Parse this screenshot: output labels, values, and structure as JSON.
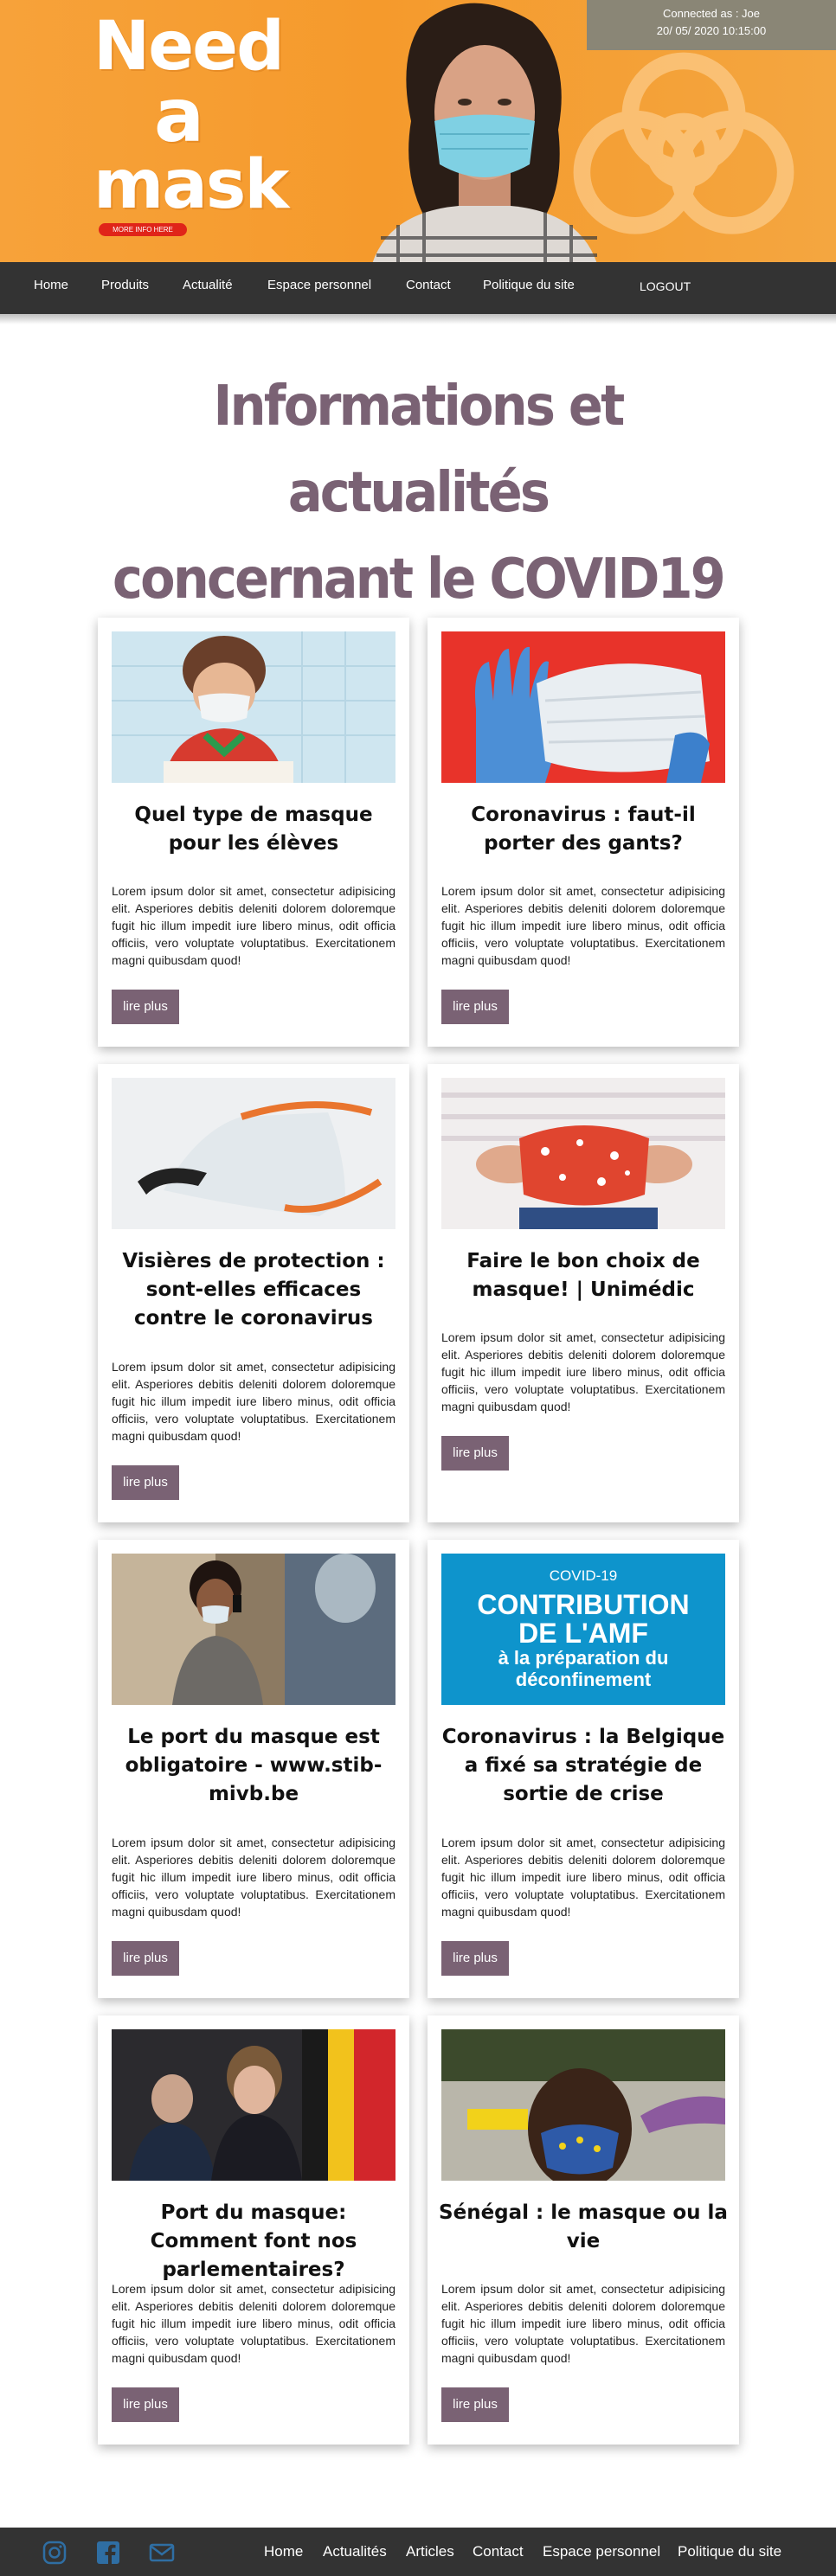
{
  "header": {
    "logo_words": [
      "Need",
      "a",
      "mask"
    ],
    "more_info_label": "MORE INFO HERE",
    "connected_label": "Connected as : Joe",
    "datetime": "20/ 05/ 2020 10:15:00"
  },
  "nav": {
    "items": [
      "Home",
      "Produits",
      "Actualité",
      "Espace personnel",
      "Contact",
      "Politique du site"
    ],
    "logout_label": "LOGOUT"
  },
  "page": {
    "title_line1": "Informations et actualités",
    "title_line2": "concernant le COVID19"
  },
  "cards": [
    {
      "title": "Quel type de masque pour les élèves",
      "image": "child-with-mask-photo"
    },
    {
      "title": "Coronavirus : faut-il porter des gants?",
      "image": "gloves-and-masks-photo"
    },
    {
      "title": "Visières de protection : sont-elles efficaces contre le coronavirus",
      "image": "face-shield-photo"
    },
    {
      "title": "Faire le bon choix de masque! | Unimédic",
      "image": "fabric-mask-photo"
    },
    {
      "title": "Le port du masque est obligatoire - www.stib-mivb.be",
      "image": "woman-on-phone-photo"
    },
    {
      "title": "Coronavirus : la Belgique a fixé sa stratégie de sortie de crise",
      "image": "amf-banner",
      "banner": {
        "line1": "COVID-19",
        "line2": "CONTRIBUTION",
        "line3": "DE L'AMF",
        "line4": "à la préparation du",
        "line5": "déconfinement"
      }
    },
    {
      "title": "Port du masque: Comment font nos parlementaires?",
      "image": "parliament-photo"
    },
    {
      "title": "Sénégal : le masque ou la vie",
      "image": "street-mural-photo"
    }
  ],
  "card_body": "Lorem ipsum dolor sit amet, consectetur adipisicing elit. Asperiores debitis deleniti dolorem doloremque fugit hic illum impedit iure libero minus, odit officia officiis, vero voluptate voluptatibus. Exercitationem magni quibusdam quod!",
  "read_more_label": "lire plus",
  "footer": {
    "icons": [
      "instagram-icon",
      "facebook-icon",
      "mail-icon"
    ],
    "links": [
      "Home",
      "Actualités",
      "Articles",
      "Contact",
      "Espace personnel",
      "Politique du site"
    ]
  },
  "colors": {
    "hero_orange": "#f59a2c",
    "nav_bg": "#333333",
    "accent_purple": "#7a6274",
    "connected_bg": "#8a8676",
    "more_info_red": "#e02419"
  }
}
